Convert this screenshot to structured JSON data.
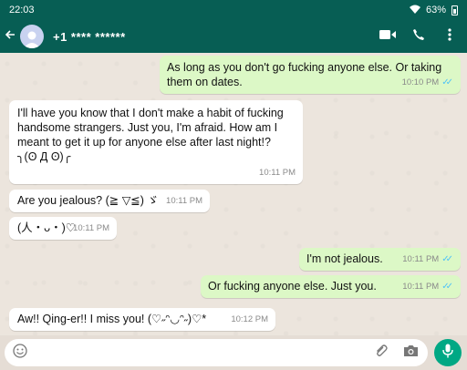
{
  "status": {
    "time": "22:03",
    "battery": "63%"
  },
  "header": {
    "contact": "+1 **** ******"
  },
  "messages": [
    {
      "dir": "out",
      "text": "As long as you don't go fucking anyone else. Or taking them on dates.",
      "time": "10:10 PM"
    },
    {
      "dir": "in",
      "text": "I'll have you know that I don't make a habit of fucking handsome strangers. Just you, I'm afraid. How am I meant to get it up for anyone else after last night!?\n╮(ʘ Д ʘ)╭",
      "time": "10:11 PM"
    },
    {
      "dir": "in",
      "text": "Are you jealous? (≧ ▽≦) ゞ",
      "time": "10:11 PM"
    },
    {
      "dir": "in",
      "text": "(人・ᴗ・)♡",
      "time": "10:11 PM"
    },
    {
      "dir": "out",
      "text": "I'm not jealous.",
      "time": "10:11 PM"
    },
    {
      "dir": "out",
      "text": "Or fucking anyone else. Just you.",
      "time": "10:11 PM"
    },
    {
      "dir": "in",
      "text": "Aw!! Qing-er!! I miss you! (♡˶ᵔ◡ᵔ˶)♡*",
      "time": "10:12 PM"
    }
  ],
  "composer": {
    "placeholder": ""
  },
  "icons": {
    "back": "arrow-back-icon",
    "video": "video-call-icon",
    "call": "phone-icon",
    "menu": "more-vert-icon",
    "emoji": "emoji-icon",
    "attach": "attach-icon",
    "camera": "camera-icon",
    "mic": "mic-icon"
  },
  "colors": {
    "header": "#075e54",
    "outgoing": "#dcf8c6",
    "incoming": "#ffffff",
    "read_ticks": "#4fc3f7",
    "mic": "#00a884"
  }
}
